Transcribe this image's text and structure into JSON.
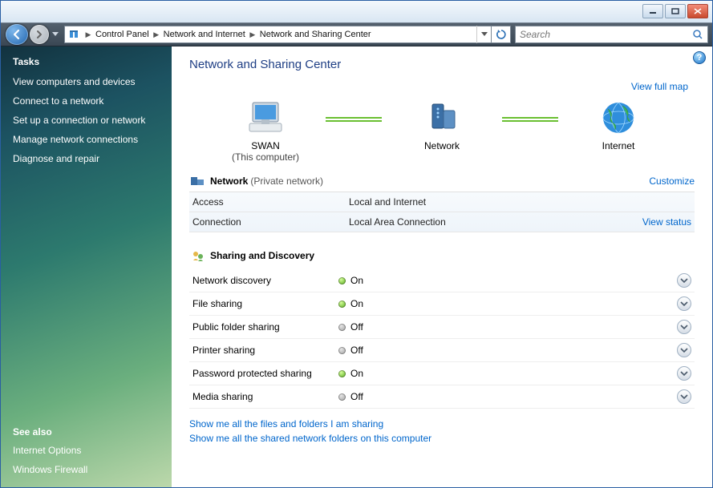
{
  "breadcrumb": {
    "items": [
      "Control Panel",
      "Network and Internet",
      "Network and Sharing Center"
    ]
  },
  "search": {
    "placeholder": "Search"
  },
  "sidebar": {
    "tasks_heading": "Tasks",
    "tasks": [
      "View computers and devices",
      "Connect to a network",
      "Set up a connection or network",
      "Manage network connections",
      "Diagnose and repair"
    ],
    "seealso_heading": "See also",
    "seealso": [
      "Internet Options",
      "Windows Firewall"
    ]
  },
  "page": {
    "title": "Network and Sharing Center",
    "view_full_map": "View full map"
  },
  "map": {
    "this_pc_name": "SWAN",
    "this_pc_sub": "(This computer)",
    "network_label": "Network",
    "internet_label": "Internet"
  },
  "network_section": {
    "title": "Network",
    "subtitle": "(Private network)",
    "customize_link": "Customize",
    "rows": [
      {
        "k": "Access",
        "v": "Local and Internet",
        "link": ""
      },
      {
        "k": "Connection",
        "v": "Local Area Connection",
        "link": "View status"
      }
    ]
  },
  "discovery_section": {
    "title": "Sharing and Discovery",
    "items": [
      {
        "name": "Network discovery",
        "on": true,
        "status_text": "On"
      },
      {
        "name": "File sharing",
        "on": true,
        "status_text": "On"
      },
      {
        "name": "Public folder sharing",
        "on": false,
        "status_text": "Off"
      },
      {
        "name": "Printer sharing",
        "on": false,
        "status_text": "Off"
      },
      {
        "name": "Password protected sharing",
        "on": true,
        "status_text": "On"
      },
      {
        "name": "Media sharing",
        "on": false,
        "status_text": "Off"
      }
    ]
  },
  "footer_links": [
    "Show me all the files and folders I am sharing",
    "Show me all the shared network folders on this computer"
  ]
}
